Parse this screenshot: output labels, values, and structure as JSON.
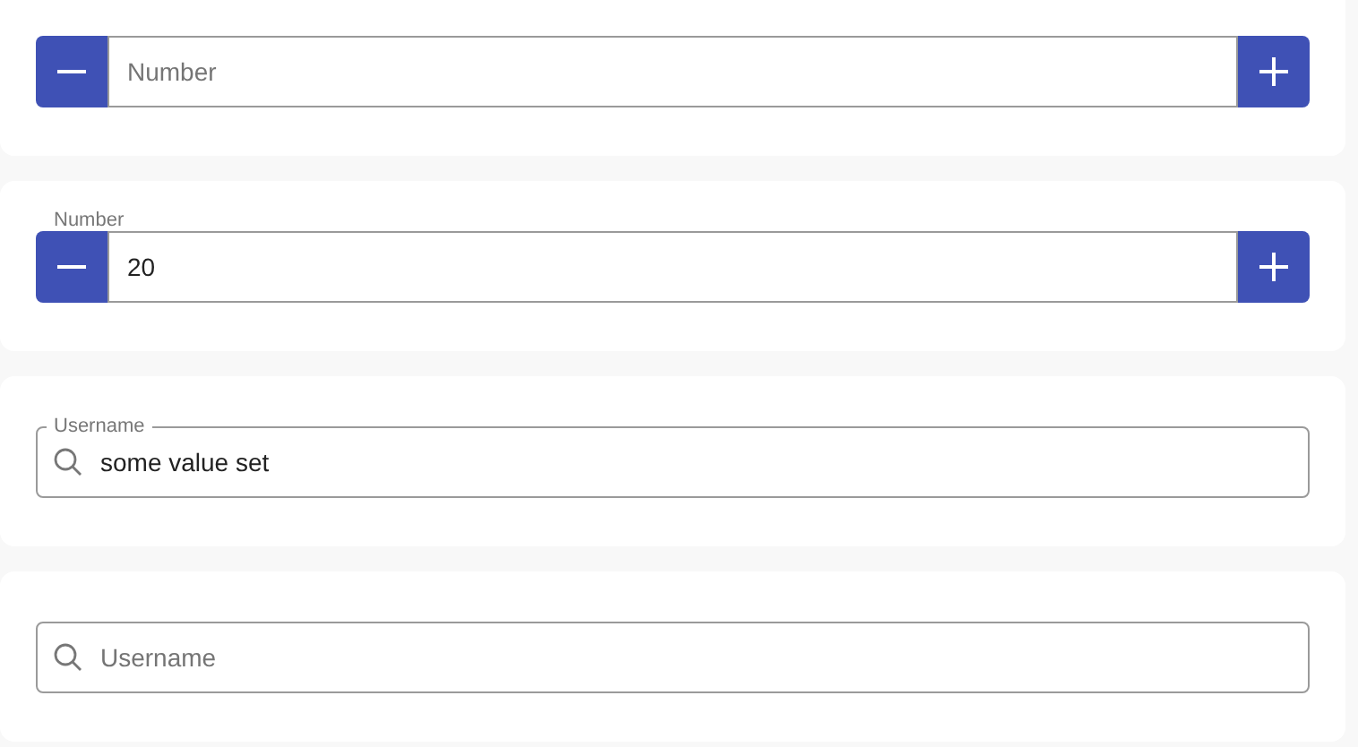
{
  "cards": [
    {
      "kind": "stepper",
      "placeholder": "Number"
    },
    {
      "kind": "stepper",
      "label": "Number",
      "value": "20"
    },
    {
      "kind": "search",
      "label": "Username",
      "value": "some value set"
    },
    {
      "kind": "search",
      "placeholder": "Username"
    }
  ]
}
